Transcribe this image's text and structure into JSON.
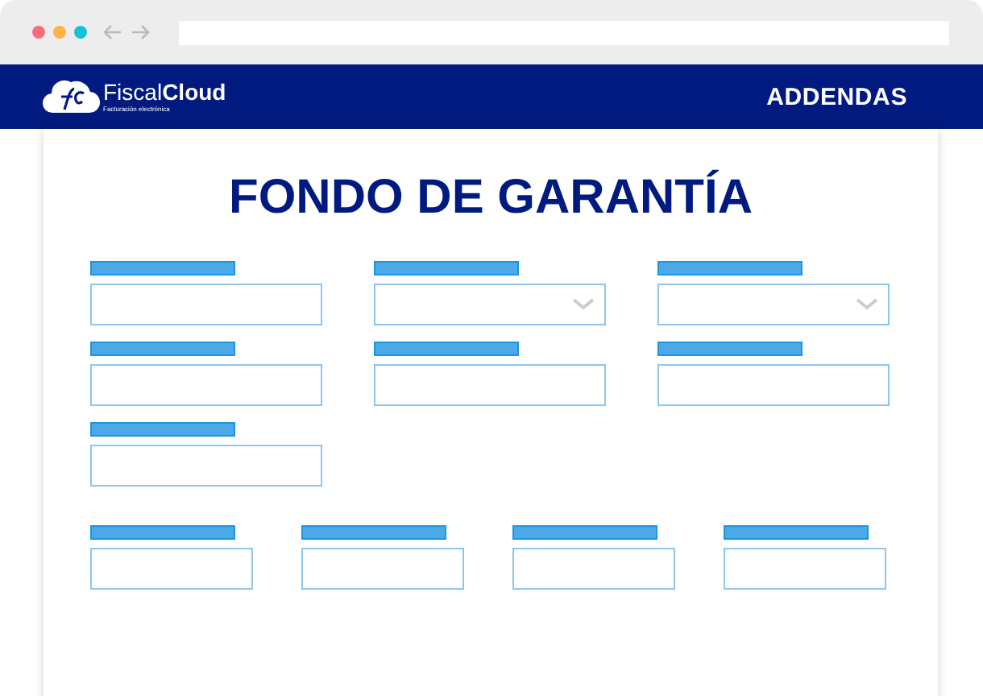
{
  "header": {
    "logo": "Fiscal**Cloud**",
    "tagline": "Facturación electrónica",
    "nav": "ADDENDAS"
  },
  "form": {
    "title": "FONDO DE GARANTÍA",
    "rows": [
      [
        {
          "kind": "text"
        },
        {
          "kind": "select"
        },
        {
          "kind": "select"
        }
      ],
      [
        {
          "kind": "text"
        },
        {
          "kind": "text"
        },
        {
          "kind": "text"
        }
      ],
      [
        {
          "kind": "text"
        }
      ],
      [
        {
          "kind": "text"
        },
        {
          "kind": "text"
        },
        {
          "kind": "text"
        },
        {
          "kind": "text"
        }
      ]
    ]
  }
}
